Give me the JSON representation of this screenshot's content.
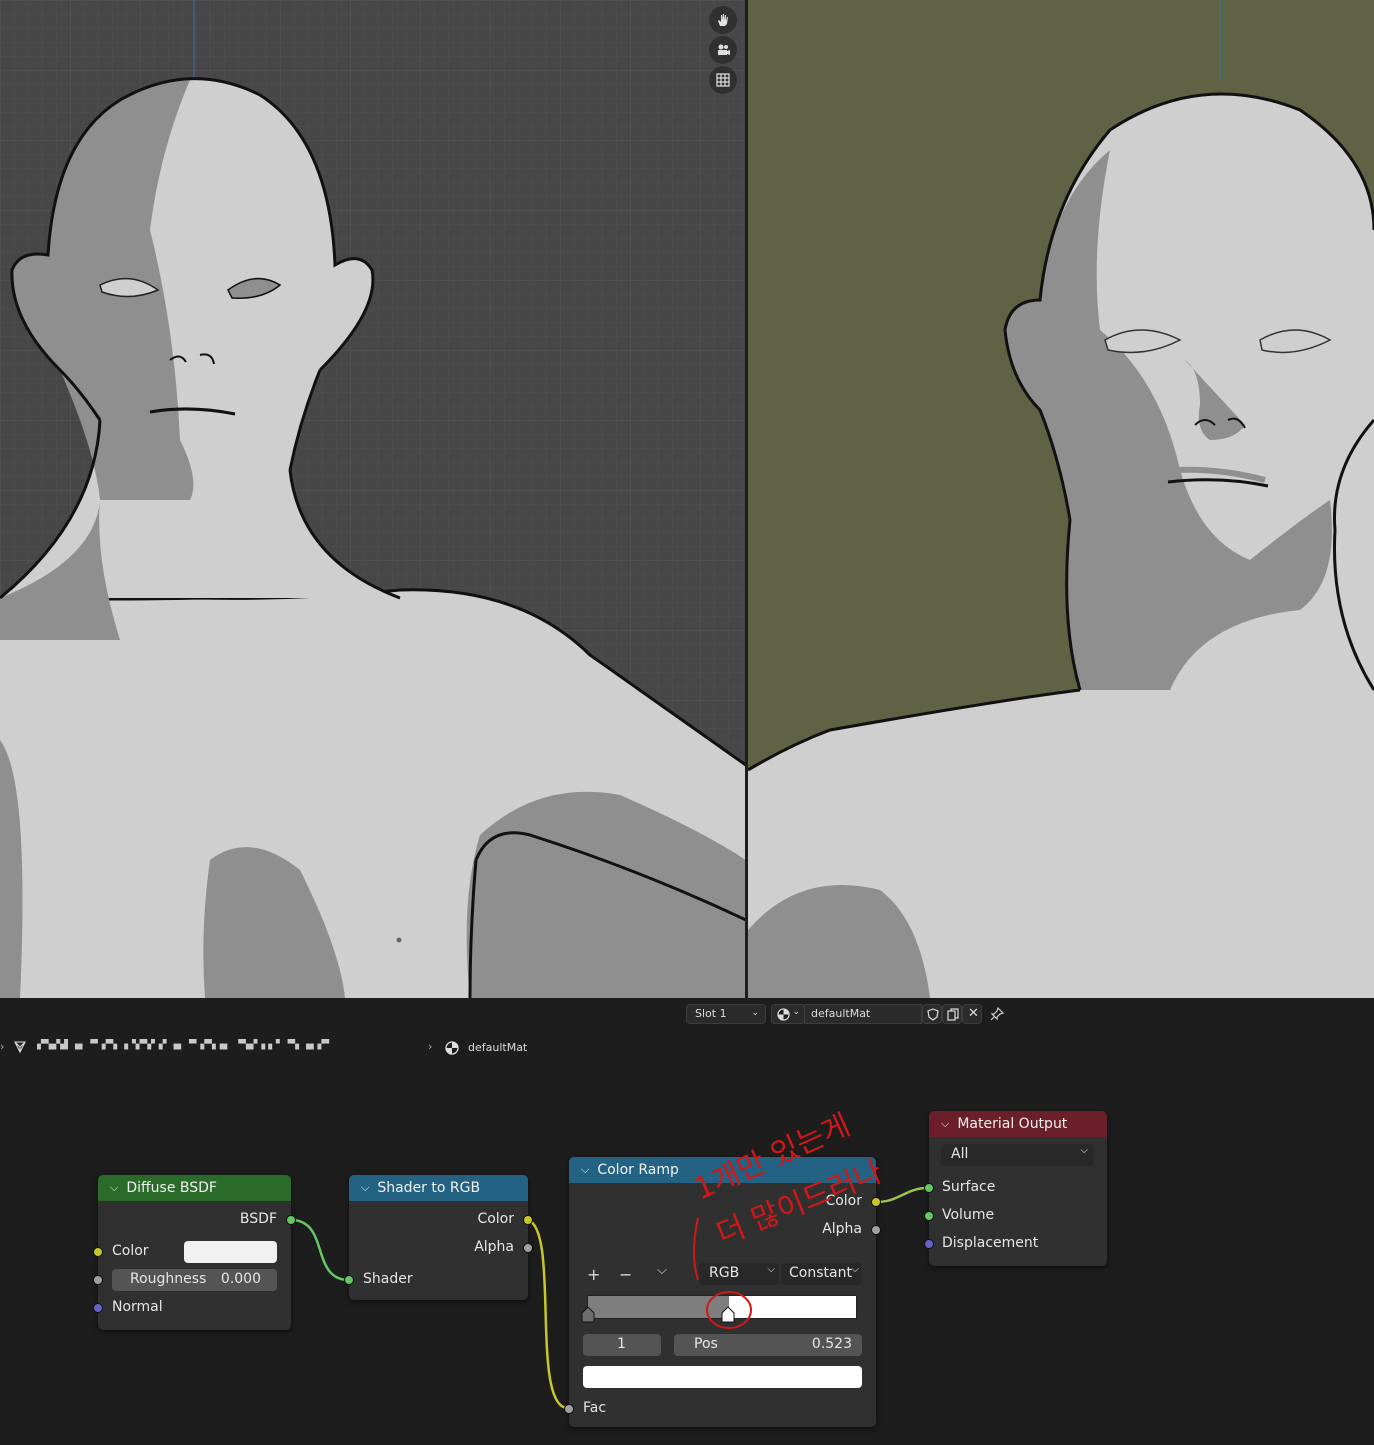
{
  "viewport": {
    "nav_icons": [
      "hand-pan-icon",
      "camera-icon",
      "grid-ortho-icon"
    ]
  },
  "header": {
    "slot_label": "Slot 1",
    "material_name": "defaultMat"
  },
  "breadcrumb": {
    "object_name": "▞▚▞▟ ▗▖▝▘▞▚ ▗▝▞▚▘▞ ▗▖▝▘▞▚▗▖ ▝▚▞▗ ▖▘▝▚ ▗▖▞▘",
    "material": "defaultMat"
  },
  "nodes": {
    "diffuse": {
      "title": "Diffuse BSDF",
      "output": "BSDF",
      "color_label": "Color",
      "roughness_label": "Roughness",
      "roughness_value": "0.000",
      "normal_label": "Normal"
    },
    "shader_to_rgb": {
      "title": "Shader to RGB",
      "out_color": "Color",
      "out_alpha": "Alpha",
      "in_shader": "Shader"
    },
    "color_ramp": {
      "title": "Color Ramp",
      "out_color": "Color",
      "out_alpha": "Alpha",
      "color_mode": "RGB",
      "interpolation": "Constant",
      "stop_index": "1",
      "pos_label": "Pos",
      "pos_value": "0.523",
      "in_fac": "Fac",
      "stop_position": 0.523
    },
    "material_output": {
      "title": "Material Output",
      "target": "All",
      "surface": "Surface",
      "volume": "Volume",
      "displacement": "Displacement"
    }
  },
  "annotation": {
    "line1": "1개만 있는게",
    "line2": "더 많이드러나",
    "color": "#d01818"
  },
  "colors": {
    "viewport_left_bg": "#474747",
    "viewport_right_bg": "#5f6244",
    "skin_light": "#cfcfcf",
    "skin_shadow": "#8f8f8f",
    "diffuse_header": "#2a6b2a",
    "converter_header": "#246283",
    "output_header": "#6b1f2a",
    "node_body": "#303030",
    "editor_bg": "#1d1d1d"
  }
}
